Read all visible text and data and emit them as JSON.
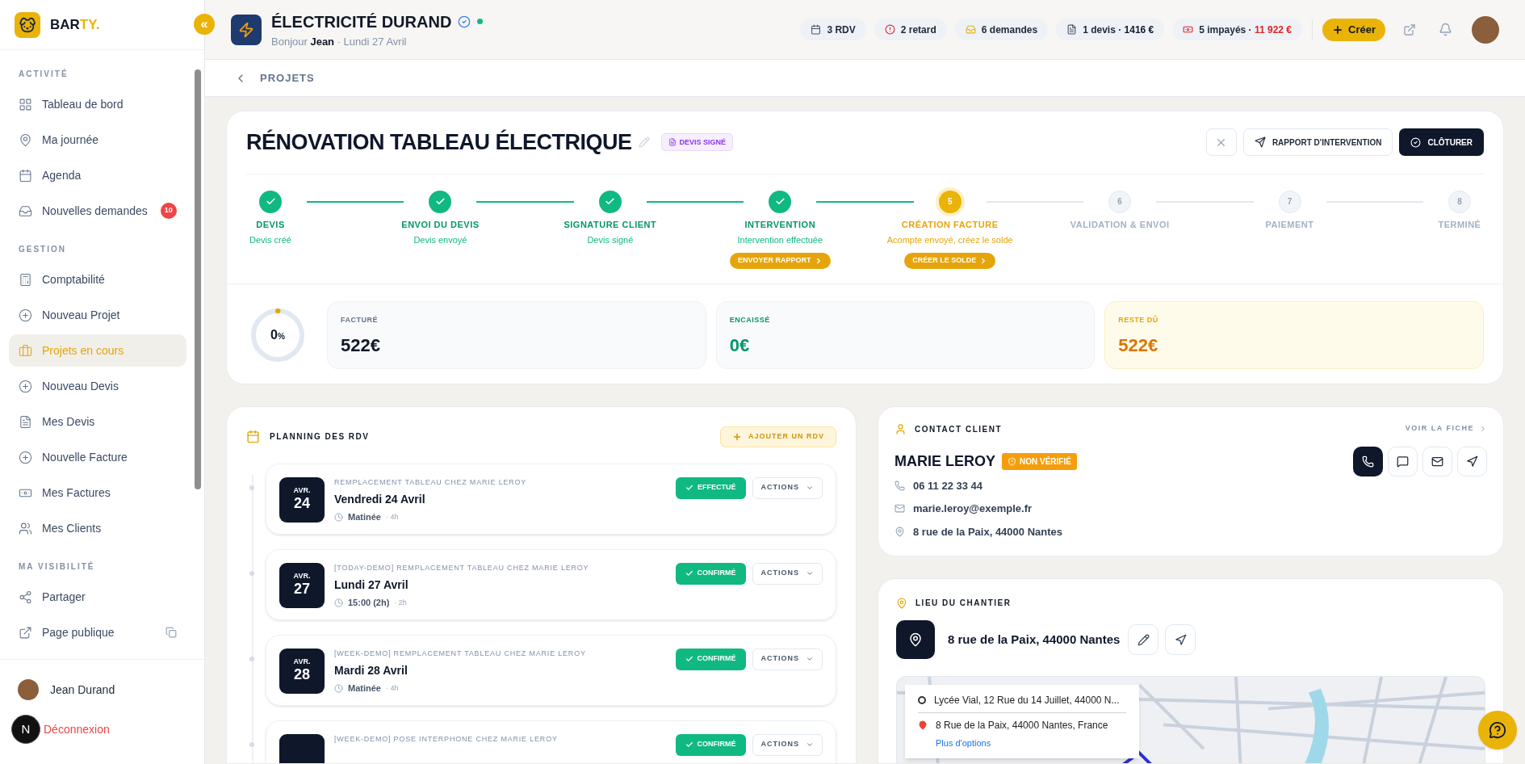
{
  "brand": {
    "name_a": "BAR",
    "name_b": "TY."
  },
  "sidebar": {
    "collapse_icon": "«",
    "sections": [
      {
        "title": "ACTIVITÉ",
        "items": [
          {
            "label": "Tableau de bord",
            "selected": false
          },
          {
            "label": "Ma journée",
            "selected": false
          },
          {
            "label": "Agenda",
            "selected": false
          },
          {
            "label": "Nouvelles demandes",
            "selected": false,
            "badge": "10"
          }
        ]
      },
      {
        "title": "GESTION",
        "items": [
          {
            "label": "Comptabilité",
            "selected": false
          },
          {
            "label": "Nouveau Projet",
            "selected": false
          },
          {
            "label": "Projets en cours",
            "selected": true
          },
          {
            "label": "Nouveau Devis",
            "selected": false
          },
          {
            "label": "Mes Devis",
            "selected": false
          },
          {
            "label": "Nouvelle Facture",
            "selected": false
          },
          {
            "label": "Mes Factures",
            "selected": false
          },
          {
            "label": "Mes Clients",
            "selected": false
          }
        ]
      },
      {
        "title": "MA VISIBILITÉ",
        "items": [
          {
            "label": "Partager",
            "selected": false
          },
          {
            "label": "Page publique",
            "selected": false
          }
        ]
      }
    ],
    "user": "Jean Durand",
    "logout": "Déconnexion",
    "dev_badge": "N"
  },
  "header": {
    "company": "ÉLECTRICITÉ DURAND",
    "verified": true,
    "online": true,
    "greeting": "Bonjour **Jean** · Lundi 27 Avril",
    "stats": [
      {
        "text": "3 RDV"
      },
      {
        "text": "2 retard"
      },
      {
        "text": "6 demandes"
      },
      {
        "kind": "plain",
        "text": "1 devis ·",
        "amount": "1416 €"
      },
      {
        "kind": "danger",
        "text": "5 impayés ·",
        "amount": "11 922 €"
      }
    ],
    "create": "Créer"
  },
  "breadcrumb": "PROJETS",
  "project": {
    "title": "RÉNOVATION TABLEAU ÉLECTRIQUE",
    "status_badge": "DEVIS SIGNÉ",
    "report_button": "RAPPORT D'INTERVENTION",
    "close_button": "CLÔTURER",
    "steps": [
      {
        "kind": "done",
        "label": "DEVIS",
        "sub": "Devis créé"
      },
      {
        "kind": "done",
        "label": "ENVOI DU DEVIS",
        "sub": "Devis envoyé"
      },
      {
        "kind": "done",
        "label": "SIGNATURE CLIENT",
        "sub": "Devis signé"
      },
      {
        "kind": "done",
        "label": "INTERVENTION",
        "sub": "Intervention effectuée",
        "action": "ENVOYER RAPPORT"
      },
      {
        "kind": "current",
        "number": "5",
        "label": "CRÉATION FACTURE",
        "sub": "Acompte envoyé, créez le solde",
        "action": "CRÉER LE SOLDE"
      },
      {
        "kind": "pending",
        "number": "6",
        "label": "VALIDATION & ENVOI"
      },
      {
        "kind": "pending",
        "number": "7",
        "label": "PAIEMENT"
      },
      {
        "kind": "pending",
        "number": "8",
        "label": "TERMINÉ"
      }
    ],
    "progress": {
      "level": 0,
      "value": "0",
      "unit": "%"
    },
    "totals": [
      {
        "kind": "neutral",
        "label": "FACTURÉ",
        "value": "522€"
      },
      {
        "kind": "success",
        "label": "ENCAISSÉ",
        "value": "0€"
      },
      {
        "kind": "warning",
        "label": "RESTE DÛ",
        "value": "522€"
      }
    ]
  },
  "planning": {
    "title": "PLANNING DES RDV",
    "add_button": "AJOUTER UN RDV",
    "appointments": [
      {
        "month": "AVR.",
        "day": "24",
        "title": "REMPLACEMENT TABLEAU CHEZ MARIE LEROY",
        "date": "Vendredi 24 Avril",
        "time": "Matinée",
        "duration": "· 4h",
        "status": "EFFECTUÉ",
        "actions": "ACTIONS"
      },
      {
        "month": "AVR.",
        "day": "27",
        "title": "[TODAY-DEMO] REMPLACEMENT TABLEAU CHEZ MARIE LEROY",
        "date": "Lundi 27 Avril",
        "time": "15:00 (2h)",
        "duration": "· 2h",
        "status": "CONFIRMÉ",
        "actions": "ACTIONS"
      },
      {
        "month": "AVR.",
        "day": "28",
        "title": "[WEEK-DEMO] REMPLACEMENT TABLEAU CHEZ MARIE LEROY",
        "date": "Mardi 28 Avril",
        "time": "Matinée",
        "duration": "· 4h",
        "status": "CONFIRMÉ",
        "actions": "ACTIONS"
      },
      {
        "title": "[WEEK-DEMO] POSE INTERPHONE CHEZ MARIE LEROY",
        "status": "CONFIRMÉ",
        "actions": "ACTIONS"
      }
    ]
  },
  "contact": {
    "title": "CONTACT CLIENT",
    "link": "VOIR LA FICHE",
    "name": "MARIE LEROY",
    "badge": "NON VÉRIFIÉ",
    "phone": "06 11 22 33 44",
    "email": "marie.leroy@exemple.fr",
    "address": "8 rue de la Paix, 44000 Nantes"
  },
  "site": {
    "title": "LIEU DU CHANTIER",
    "address": "8 rue de la Paix, 44000 Nantes",
    "directions": {
      "from": "Lycée Vial, 12 Rue du 14 Juillet, 44000 N...",
      "to": "8 Rue de la Paix, 44000 Nantes, France",
      "more": "Plus d'options"
    }
  }
}
